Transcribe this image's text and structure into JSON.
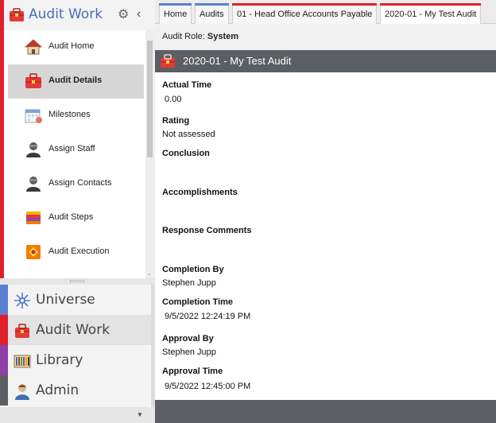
{
  "sidebar": {
    "title": "Audit Work",
    "icons": {
      "settings": "gear-icon",
      "collapse": "chevron-left-icon"
    },
    "items": [
      {
        "label": "Audit Home",
        "icon": "home-icon",
        "active": false
      },
      {
        "label": "Audit Details",
        "icon": "briefcase-icon",
        "active": true
      },
      {
        "label": "Milestones",
        "icon": "calendar-icon",
        "active": false
      },
      {
        "label": "Assign Staff",
        "icon": "person-icon",
        "active": false
      },
      {
        "label": "Assign Contacts",
        "icon": "person-icon",
        "active": false
      },
      {
        "label": "Audit Steps",
        "icon": "book-icon",
        "active": false
      },
      {
        "label": "Audit Execution",
        "icon": "execution-icon",
        "active": false
      }
    ],
    "modules": [
      {
        "label": "Universe",
        "color": "#5b7fd1",
        "icon": "universe-icon",
        "active": false
      },
      {
        "label": "Audit Work",
        "color": "#e0202d",
        "icon": "briefcase-icon",
        "active": true
      },
      {
        "label": "Library",
        "color": "#8e3fa8",
        "icon": "library-icon",
        "active": false
      },
      {
        "label": "Admin",
        "color": "#5b5f63",
        "icon": "admin-icon",
        "active": false
      }
    ]
  },
  "tabs": [
    {
      "label": "Home",
      "accent": "#5b7fd1",
      "active": false
    },
    {
      "label": "Audits",
      "accent": "#5b7fd1",
      "active": false
    },
    {
      "label": "01 - Head Office Accounts Payable",
      "accent": "#e0202d",
      "active": false
    },
    {
      "label": "2020-01 - My Test Audit",
      "accent": "#e0202d",
      "active": true
    }
  ],
  "audit_role": {
    "label": "Audit Role:",
    "value": "System"
  },
  "page_title": "2020-01 - My Test Audit",
  "fields": {
    "actual_time": {
      "label": "Actual Time",
      "value": "0.00"
    },
    "rating": {
      "label": "Rating",
      "value": "Not assessed"
    },
    "conclusion": {
      "label": "Conclusion",
      "value": ""
    },
    "accomplishments": {
      "label": "Accomplishments",
      "value": ""
    },
    "response_comments": {
      "label": "Response Comments",
      "value": ""
    },
    "completion_by": {
      "label": "Completion By",
      "value": "Stephen Jupp"
    },
    "completion_time": {
      "label": "Completion Time",
      "value": "9/5/2022 12:24:19 PM"
    },
    "approval_by": {
      "label": "Approval By",
      "value": "Stephen Jupp"
    },
    "approval_time": {
      "label": "Approval Time",
      "value": "9/5/2022 12:45:00 PM"
    }
  },
  "colors": {
    "accent_red": "#e0202d",
    "accent_blue": "#5b7fd1",
    "header_dark": "#5b5f63"
  }
}
